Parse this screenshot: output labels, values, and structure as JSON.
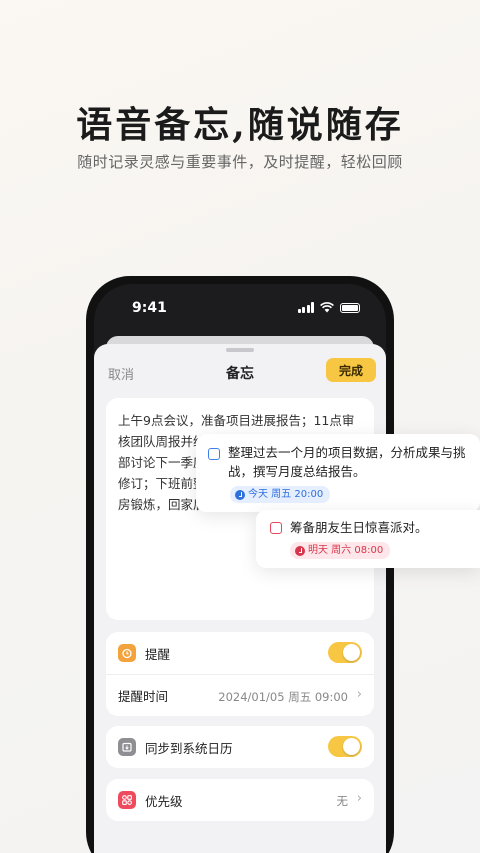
{
  "promo": {
    "headline": "语音备忘,随说随存",
    "subheadline": "随时记录灵感与重要事件，及时提醒，轻松回顾"
  },
  "status_bar": {
    "time": "9:41"
  },
  "nav": {
    "cancel": "取消",
    "title": "备忘",
    "done": "完成"
  },
  "note": {
    "text": "上午9点会议，准备项目进展报告；11点审核团队周报并给予反馈；下午2点，与市场部讨论下一季度推广计划；下午4点，预算修订；下班前整理今日工作；晚上7点健身房锻炼，回家后阅读新买的书籍。"
  },
  "settings": {
    "reminder_label": "提醒",
    "reminder_on": true,
    "reminder_time_label": "提醒时间",
    "reminder_time_value": "2024/01/05 周五 09:00",
    "sync_label": "同步到系统日历",
    "sync_on": true,
    "priority_label": "优先级",
    "priority_value": "无"
  },
  "tasks": [
    {
      "text": "整理过去一个月的项目数据，分析成果与挑战，撰写月度总结报告。",
      "tag": "今天 周五 20:00",
      "color": "#2f6fdc"
    },
    {
      "text": "筹备朋友生日惊喜派对。",
      "tag": "明天 周六 08:00",
      "color": "#d8344b"
    }
  ],
  "colors": {
    "accent": "#f7c744"
  }
}
